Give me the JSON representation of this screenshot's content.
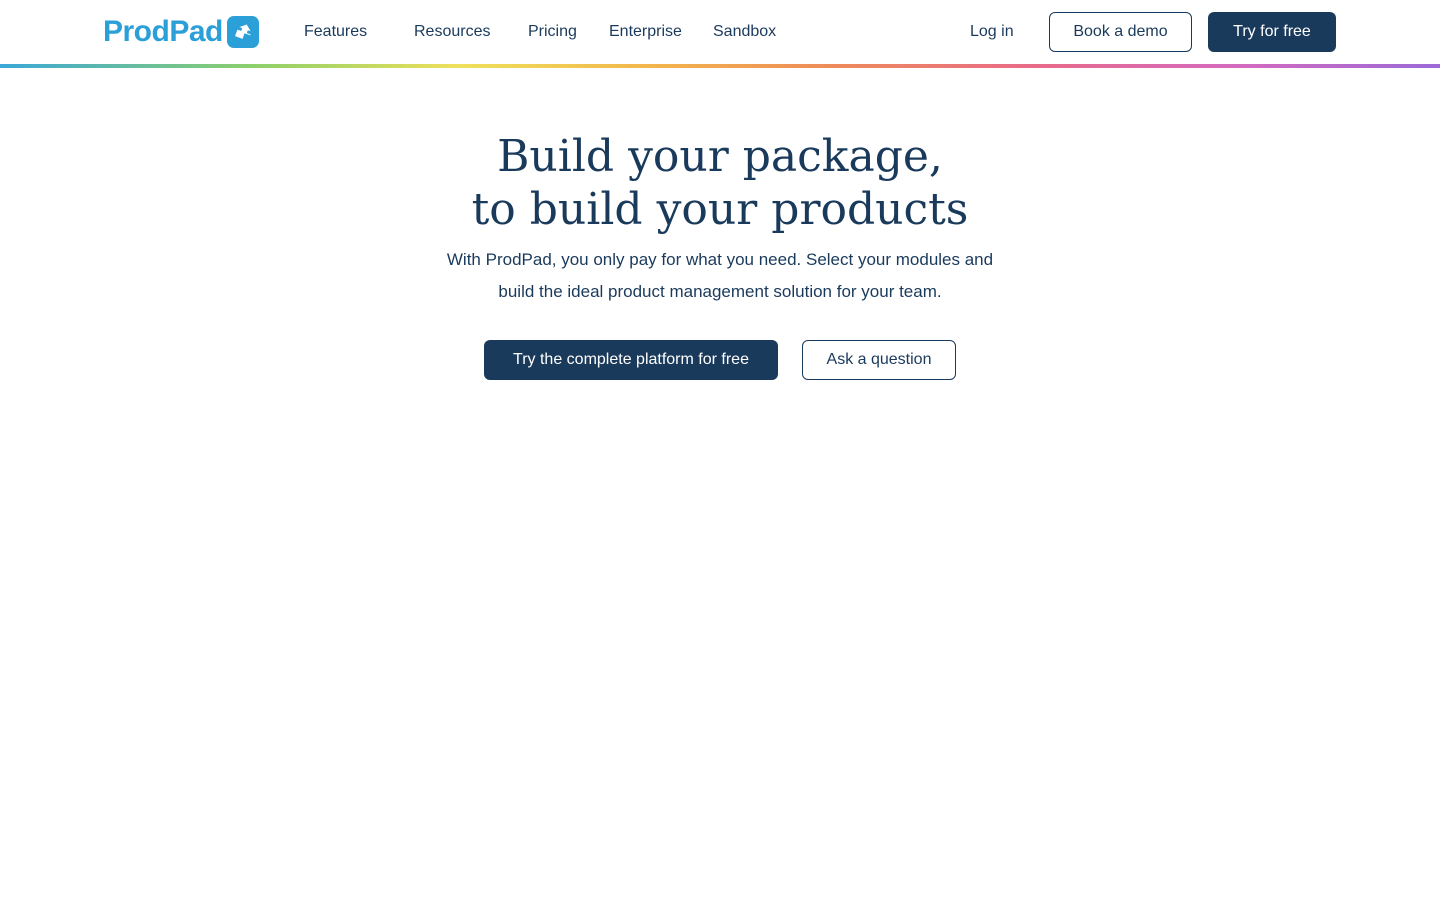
{
  "brand": {
    "name": "ProdPad",
    "logo_icon": "arrow-up-right-icon",
    "color": "#2a9fd8"
  },
  "nav": {
    "items": [
      {
        "label": "Features"
      },
      {
        "label": "Resources"
      },
      {
        "label": "Pricing"
      },
      {
        "label": "Enterprise"
      },
      {
        "label": "Sandbox"
      }
    ],
    "login_label": "Log in",
    "demo_label": "Book a demo",
    "trial_label": "Try for free"
  },
  "hero": {
    "title_line1": "Build your package,",
    "title_line2": "to build your products",
    "subtitle_line1": "With ProdPad, you only pay for what you need. Select your modules and",
    "subtitle_line2": "build the ideal product management solution for your team.",
    "primary_cta": "Try the complete platform for free",
    "secondary_cta": "Ask a question"
  },
  "colors": {
    "navy": "#1a3a5c",
    "brand_blue": "#2a9fd8",
    "background": "#ffffff"
  }
}
